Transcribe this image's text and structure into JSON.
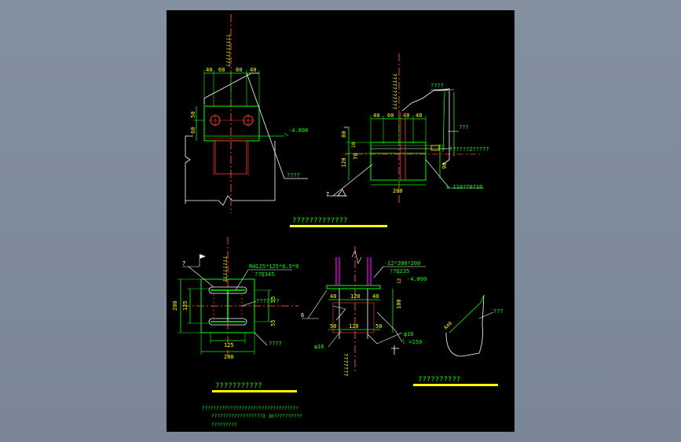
{
  "colors": {
    "background": "#7e8a99",
    "sheet": "#000000",
    "green": "#00ff00",
    "yellow": "#ffff00",
    "red": "#ff3b3b",
    "cyan": "#00ffff",
    "white": "#ffffff",
    "magenta": "#ff00ff",
    "orange": "#ff8c00"
  },
  "detail1": {
    "dims_top": [
      "40",
      "60",
      "60",
      "40"
    ],
    "dims_left": [
      "50",
      "60"
    ],
    "level": "-4.800",
    "vertical_note": "??????????",
    "callout": "????"
  },
  "detail2": {
    "dims_top": [
      "40",
      "60",
      "40",
      "40"
    ],
    "dims_left": [
      "80",
      "10",
      "70",
      "120"
    ],
    "width": "200",
    "right_dim": "90",
    "vertical_note": "???????????",
    "callout_top": "????",
    "callout_side": "???",
    "callout_bolt": "??????2?????",
    "callout_angle": "L 110?70?10",
    "weld": "7"
  },
  "title1": "?????????????",
  "detail3": {
    "weld": "7",
    "vertical_note": "????????",
    "section": "RH125*125*6.5*9",
    "material": "??Q345",
    "note_right": "???????",
    "dim_55a": "55",
    "dim_55b": "55",
    "dim_125_left": "125",
    "dim_200_left": "200",
    "dim_125_bottom": "125",
    "dim_200_bottom": "200",
    "callout": "????",
    "bottom_note": "???????"
  },
  "detail4": {
    "plate": "-12*200*200",
    "material": "??Q235",
    "level": "-4.800",
    "dim_12": "12",
    "dims_top": [
      "40",
      "120",
      "40"
    ],
    "dims_bottom": [
      "50",
      "120",
      "50"
    ],
    "dim_100": "100",
    "bolt_top": "φ16",
    "bolt_bottom": "φ16",
    "len": "l =150",
    "weld": "6"
  },
  "detail5": {
    "radius": "R40",
    "callout": "???"
  },
  "title2": "???????????",
  "title3": "??????????",
  "notes": [
    "??????????????????????????????????",
    "??????????????????3   16??????????",
    "?????????"
  ]
}
